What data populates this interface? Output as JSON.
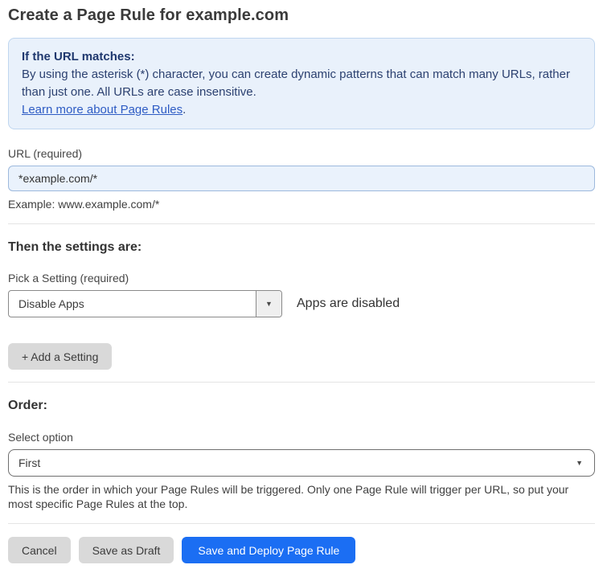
{
  "page": {
    "title": "Create a Page Rule for example.com"
  },
  "info_box": {
    "heading": "If the URL matches:",
    "body": "By using the asterisk (*) character, you can create dynamic patterns that can match many URLs, rather than just one. All URLs are case insensitive.",
    "link_text": "Learn more about Page Rules",
    "link_suffix": "."
  },
  "url_field": {
    "label": "URL (required)",
    "value": "*example.com/*",
    "helper": "Example: www.example.com/*"
  },
  "settings": {
    "heading": "Then the settings are:",
    "picker_label": "Pick a Setting (required)",
    "picker_value": "Disable Apps",
    "status_text": "Apps are disabled",
    "add_button_label": "+ Add a Setting"
  },
  "order": {
    "heading": "Order:",
    "label": "Select option",
    "value": "First",
    "helper": "This is the order in which your Page Rules will be triggered. Only one Page Rule will trigger per URL, so put your most specific Page Rules at the top."
  },
  "footer": {
    "cancel": "Cancel",
    "save_draft": "Save as Draft",
    "save_deploy": "Save and Deploy Page Rule"
  },
  "icons": {
    "caret_down": "▼"
  },
  "colors": {
    "info_box_bg": "#e9f1fb",
    "info_box_border": "#bfd6ef",
    "info_text": "#2c4170",
    "link": "#2e5cc4",
    "url_input_bg": "#eaf2fc",
    "url_input_border": "#9db9dd",
    "primary_button": "#1b6ef3",
    "secondary_button": "#d9d9d9"
  }
}
